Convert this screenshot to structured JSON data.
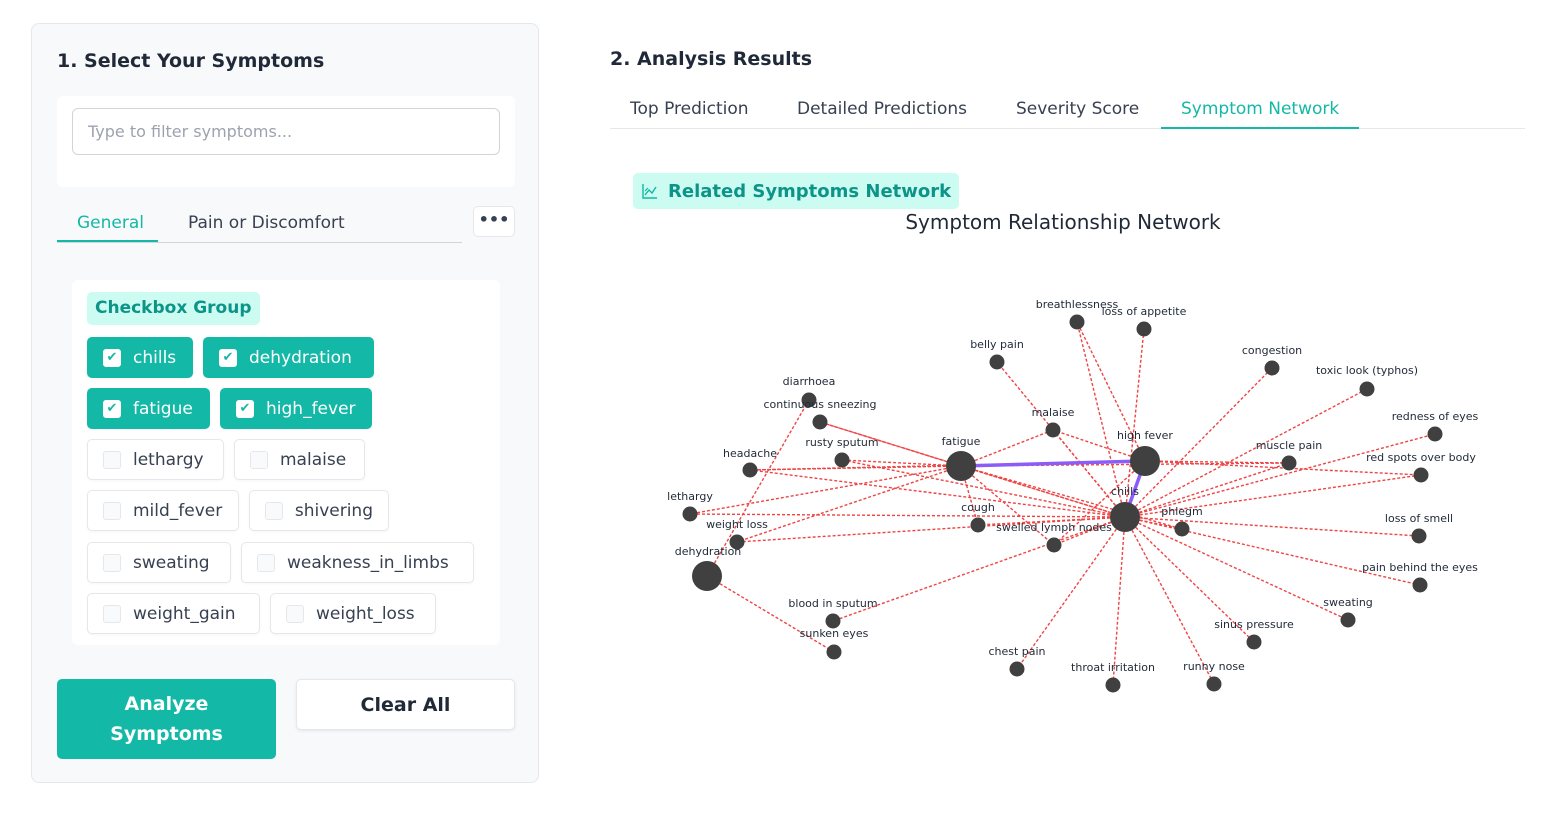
{
  "left_panel": {
    "title": "1. Select Your Symptoms",
    "filter_placeholder": "Type to filter symptoms...",
    "category_tabs": [
      {
        "label": "General",
        "active": true
      },
      {
        "label": "Pain or Discomfort",
        "active": false
      }
    ],
    "more_icon": "ellipsis-icon",
    "group_label": "Checkbox Group",
    "symptoms": [
      {
        "label": "chills",
        "checked": true
      },
      {
        "label": "dehydration",
        "checked": true
      },
      {
        "label": "fatigue",
        "checked": true
      },
      {
        "label": "high_fever",
        "checked": true
      },
      {
        "label": "lethargy",
        "checked": false
      },
      {
        "label": "malaise",
        "checked": false
      },
      {
        "label": "mild_fever",
        "checked": false
      },
      {
        "label": "shivering",
        "checked": false
      },
      {
        "label": "sweating",
        "checked": false
      },
      {
        "label": "weakness_in_limbs",
        "checked": false
      },
      {
        "label": "weight_gain",
        "checked": false
      },
      {
        "label": "weight_loss",
        "checked": false
      }
    ],
    "analyze_label": "Analyze Symptoms",
    "clear_label": "Clear All"
  },
  "results": {
    "title": "2. Analysis Results",
    "tabs": [
      {
        "label": "Top Prediction",
        "active": false
      },
      {
        "label": "Detailed Predictions",
        "active": false
      },
      {
        "label": "Severity Score",
        "active": false
      },
      {
        "label": "Symptom Network",
        "active": true
      }
    ],
    "network_section_label": "Related Symptoms Network",
    "network_icon": "chart-icon"
  },
  "chart_data": {
    "type": "network",
    "title": "Symptom Relationship Network",
    "colors": {
      "edge": "#ef4444",
      "strong_edge": "#8b5cf6",
      "node": "#404040",
      "accent": "#14b8a6"
    },
    "nodes": [
      {
        "id": "fatigue",
        "label": "fatigue",
        "selected": true
      },
      {
        "id": "high fever",
        "label": "high fever",
        "selected": true
      },
      {
        "id": "chills",
        "label": "chills",
        "selected": true
      },
      {
        "id": "dehydration",
        "label": "dehydration",
        "selected": true
      },
      {
        "id": "breathlessness",
        "label": "breathlessness",
        "selected": false
      },
      {
        "id": "loss of appetite",
        "label": "loss of appetite",
        "selected": false
      },
      {
        "id": "belly pain",
        "label": "belly pain",
        "selected": false
      },
      {
        "id": "congestion",
        "label": "congestion",
        "selected": false
      },
      {
        "id": "toxic look (typhos)",
        "label": "toxic look (typhos)",
        "selected": false
      },
      {
        "id": "diarrhoea",
        "label": "diarrhoea",
        "selected": false
      },
      {
        "id": "continuous sneezing",
        "label": "continuous sneezing",
        "selected": false
      },
      {
        "id": "malaise",
        "label": "malaise",
        "selected": false
      },
      {
        "id": "redness of eyes",
        "label": "redness of eyes",
        "selected": false
      },
      {
        "id": "rusty sputum",
        "label": "rusty sputum",
        "selected": false
      },
      {
        "id": "muscle pain",
        "label": "muscle pain",
        "selected": false
      },
      {
        "id": "headache",
        "label": "headache",
        "selected": false
      },
      {
        "id": "red spots over body",
        "label": "red spots over body",
        "selected": false
      },
      {
        "id": "lethargy",
        "label": "lethargy",
        "selected": false
      },
      {
        "id": "cough",
        "label": "cough",
        "selected": false
      },
      {
        "id": "phlegm",
        "label": "phlegm",
        "selected": false
      },
      {
        "id": "loss of smell",
        "label": "loss of smell",
        "selected": false
      },
      {
        "id": "weight loss",
        "label": "weight loss",
        "selected": false
      },
      {
        "id": "swelled lymph nodes",
        "label": "swelled lymph nodes",
        "selected": false
      },
      {
        "id": "pain behind the eyes",
        "label": "pain behind the eyes",
        "selected": false
      },
      {
        "id": "blood in sputum",
        "label": "blood in sputum",
        "selected": false
      },
      {
        "id": "sweating",
        "label": "sweating",
        "selected": false
      },
      {
        "id": "sunken eyes",
        "label": "sunken eyes",
        "selected": false
      },
      {
        "id": "sinus pressure",
        "label": "sinus pressure",
        "selected": false
      },
      {
        "id": "chest pain",
        "label": "chest pain",
        "selected": false
      },
      {
        "id": "throat irritation",
        "label": "throat irritation",
        "selected": false
      },
      {
        "id": "runny nose",
        "label": "runny nose",
        "selected": false
      }
    ],
    "strong_edges": [
      [
        "fatigue",
        "high fever"
      ],
      [
        "high fever",
        "chills"
      ]
    ],
    "edges": [
      [
        "fatigue",
        "chills"
      ],
      [
        "fatigue",
        "malaise"
      ],
      [
        "fatigue",
        "headache"
      ],
      [
        "fatigue",
        "lethargy"
      ],
      [
        "fatigue",
        "weight loss"
      ],
      [
        "fatigue",
        "rusty sputum"
      ],
      [
        "fatigue",
        "continuous sneezing"
      ],
      [
        "fatigue",
        "swelled lymph nodes"
      ],
      [
        "fatigue",
        "phlegm"
      ],
      [
        "fatigue",
        "cough"
      ],
      [
        "fatigue",
        "muscle pain"
      ],
      [
        "chills",
        "breathlessness"
      ],
      [
        "chills",
        "loss of appetite"
      ],
      [
        "chills",
        "belly pain"
      ],
      [
        "chills",
        "congestion"
      ],
      [
        "chills",
        "toxic look (typhos)"
      ],
      [
        "chills",
        "redness of eyes"
      ],
      [
        "chills",
        "muscle pain"
      ],
      [
        "chills",
        "red spots over body"
      ],
      [
        "chills",
        "headache"
      ],
      [
        "chills",
        "rusty sputum"
      ],
      [
        "chills",
        "continuous sneezing"
      ],
      [
        "chills",
        "malaise"
      ],
      [
        "chills",
        "cough"
      ],
      [
        "chills",
        "phlegm"
      ],
      [
        "chills",
        "loss of smell"
      ],
      [
        "chills",
        "pain behind the eyes"
      ],
      [
        "chills",
        "sweating"
      ],
      [
        "chills",
        "sinus pressure"
      ],
      [
        "chills",
        "runny nose"
      ],
      [
        "chills",
        "throat irritation"
      ],
      [
        "chills",
        "chest pain"
      ],
      [
        "chills",
        "blood in sputum"
      ],
      [
        "chills",
        "swelled lymph nodes"
      ],
      [
        "chills",
        "weight loss"
      ],
      [
        "chills",
        "lethargy"
      ],
      [
        "high fever",
        "malaise"
      ],
      [
        "high fever",
        "headache"
      ],
      [
        "high fever",
        "red spots over body"
      ],
      [
        "high fever",
        "muscle pain"
      ],
      [
        "high fever",
        "swelled lymph nodes"
      ],
      [
        "high fever",
        "breathlessness"
      ],
      [
        "dehydration",
        "diarrhoea"
      ],
      [
        "dehydration",
        "sunken eyes"
      ]
    ]
  }
}
